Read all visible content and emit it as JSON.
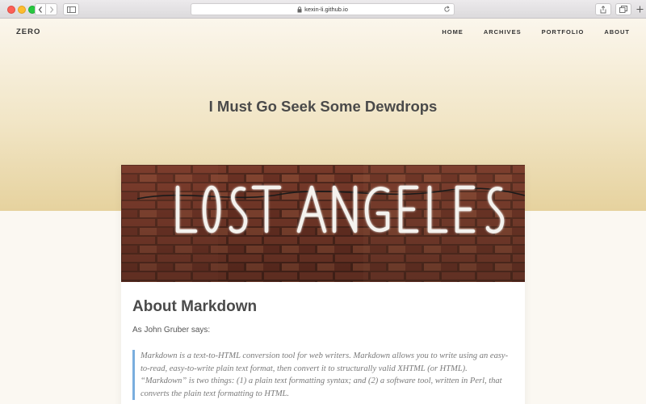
{
  "browser": {
    "url": "kexin-li.github.io"
  },
  "site": {
    "brand": "ZERO",
    "nav": [
      {
        "label": "HOME"
      },
      {
        "label": "ARCHIVES"
      },
      {
        "label": "PORTFOLIO"
      },
      {
        "label": "ABOUT"
      }
    ]
  },
  "post": {
    "title": "I Must Go Seek Some Dewdrops",
    "cover_image_text": "LOST ANGELES",
    "heading": "About Markdown",
    "intro": "As John Gruber says:",
    "quote": "Markdown is a text-to-HTML conversion tool for web writers. Markdown allows you to write using an easy-to-read, easy-to-write plain text format, then convert it to structurally valid XHTML (or HTML). “Markdown” is two things: (1) a plain text formatting syntax; and (2) a software tool, written in Perl, that converts the plain text formatting to HTML."
  },
  "colors": {
    "hero_top": "#fbf6ec",
    "hero_bottom": "#e6d29e",
    "quote_border": "#7aaede",
    "neon": "#f4f2ee",
    "brick": "#8a3f2c"
  },
  "icons": {
    "traffic_lights": [
      "close-dot",
      "minimize-dot",
      "maximize-dot"
    ],
    "toolbar": [
      "back-icon",
      "forward-icon",
      "sidebar-icon",
      "lock-icon",
      "reload-icon",
      "share-icon",
      "tabs-icon",
      "new-tab-icon"
    ]
  }
}
